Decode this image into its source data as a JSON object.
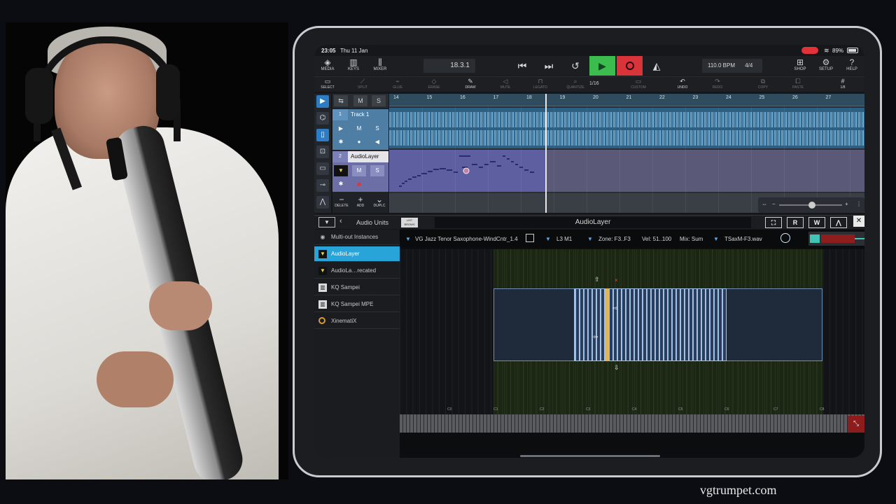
{
  "status_bar": {
    "time": "23:05",
    "date": "Thu 11 Jan",
    "battery": "89%"
  },
  "toolbar": {
    "media": "MEDIA",
    "keys": "KEYS",
    "mixer": "MIXER",
    "position": "18.3.1",
    "bpm": "110.0 BPM",
    "time_signature": "4/4",
    "shop": "SHOP",
    "setup": "SETUP",
    "help": "HELP"
  },
  "tools": {
    "select": "SELECT",
    "split": "SPLIT",
    "glue": "GLUE",
    "erase": "ERASE",
    "draw": "DRAW",
    "mute": "MUTE",
    "legato": "LEGATO",
    "quantize": "QUANTIZE",
    "quantize_value": "1/16",
    "custom": "CUSTOM",
    "undo": "UNDO",
    "redo": "REDO",
    "copy": "COPY",
    "paste": "PASTE",
    "grid": "1/8"
  },
  "tracks": {
    "header_m": "M",
    "header_s": "S",
    "track1": {
      "number": "1",
      "name": "Track 1",
      "m": "M",
      "s": "S"
    },
    "track2": {
      "number": "2",
      "name": "AudioLayer",
      "m": "M",
      "s": "S"
    },
    "delete": "DELETE",
    "add": "ADD",
    "duplicate": "DUPLC"
  },
  "ruler_bars": [
    "14",
    "15",
    "16",
    "17",
    "18",
    "19",
    "20",
    "21",
    "22",
    "23",
    "24",
    "25",
    "26",
    "27"
  ],
  "plugin_bar": {
    "section": "Audio Units",
    "list_btn_1": "LIST",
    "list_btn_2": "BROWS",
    "title": "AudioLayer",
    "r": "R",
    "w": "W"
  },
  "plugin_list": [
    {
      "label": "Multi-out Instances"
    },
    {
      "label": "AudioLayer"
    },
    {
      "label": "AudioLa…recated"
    },
    {
      "label": "KQ Sampei"
    },
    {
      "label": "KQ Sampei MPE"
    },
    {
      "label": "XinematiX"
    }
  ],
  "sampler": {
    "preset": "VG Jazz Tenor Saxophone-WindCntr_1.4",
    "layer": "L3 M1",
    "zone": "Zone: F3..F3",
    "velocity": "Vel: 51..100",
    "mix": "Mix: Sum",
    "sample": "TSaxM-F3.wav",
    "octaves": [
      "C0",
      "C1",
      "C2",
      "C3",
      "C4",
      "C5",
      "C6",
      "C7",
      "C8"
    ]
  },
  "watermark": "vgtrumpet.com",
  "colors": {
    "play": "#3cbb4f",
    "record": "#d8343a",
    "accent": "#28a4d8",
    "track1": "#2d5f83",
    "track2": "#5e5fa0"
  }
}
